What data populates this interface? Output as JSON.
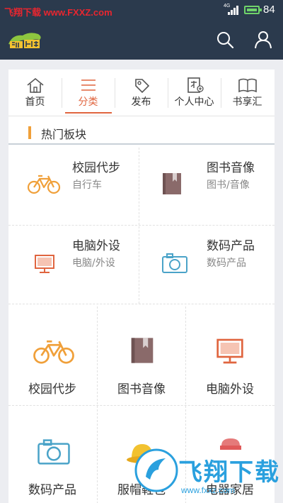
{
  "status_bar": {
    "watermark": "飞翔下载 www.FXXZ.com",
    "network": "4G",
    "battery": "84"
  },
  "header": {
    "logo": "淘书",
    "search_icon": "search-icon",
    "user_icon": "user-icon"
  },
  "tabs": [
    {
      "label": "首页",
      "icon": "home-icon"
    },
    {
      "label": "分类",
      "icon": "list-icon"
    },
    {
      "label": "发布",
      "icon": "tag-icon"
    },
    {
      "label": "个人中心",
      "icon": "person-card-icon"
    },
    {
      "label": "书享汇",
      "icon": "book-icon"
    }
  ],
  "active_tab": 1,
  "section": {
    "title": "热门板块"
  },
  "hot_items": [
    {
      "title": "校园代步",
      "subtitle": "自行车",
      "icon": "bicycle-icon"
    },
    {
      "title": "图书音像",
      "subtitle": "图书/音像",
      "icon": "book-icon"
    },
    {
      "title": "电脑外设",
      "subtitle": "电脑/外设",
      "icon": "monitor-icon"
    },
    {
      "title": "数码产品",
      "subtitle": "数码产品",
      "icon": "camera-icon"
    }
  ],
  "grid_items": [
    {
      "label": "校园代步",
      "icon": "bicycle-icon"
    },
    {
      "label": "图书音像",
      "icon": "book-icon"
    },
    {
      "label": "电脑外设",
      "icon": "monitor-icon"
    },
    {
      "label": "数码产品",
      "icon": "camera-icon"
    },
    {
      "label": "服帽鞋包",
      "icon": "hat-icon"
    },
    {
      "label": "电器家居",
      "icon": "appliance-icon"
    }
  ],
  "watermark_bottom": {
    "text": "飞翔下载",
    "url": "www.fxxz.com"
  },
  "colors": {
    "header_bg": "#2b3a4d",
    "accent": "#e0653f",
    "bike": "#f0a03a",
    "book": "#8a6a6a",
    "monitor": "#e0653f",
    "camera": "#4aa3c8"
  }
}
